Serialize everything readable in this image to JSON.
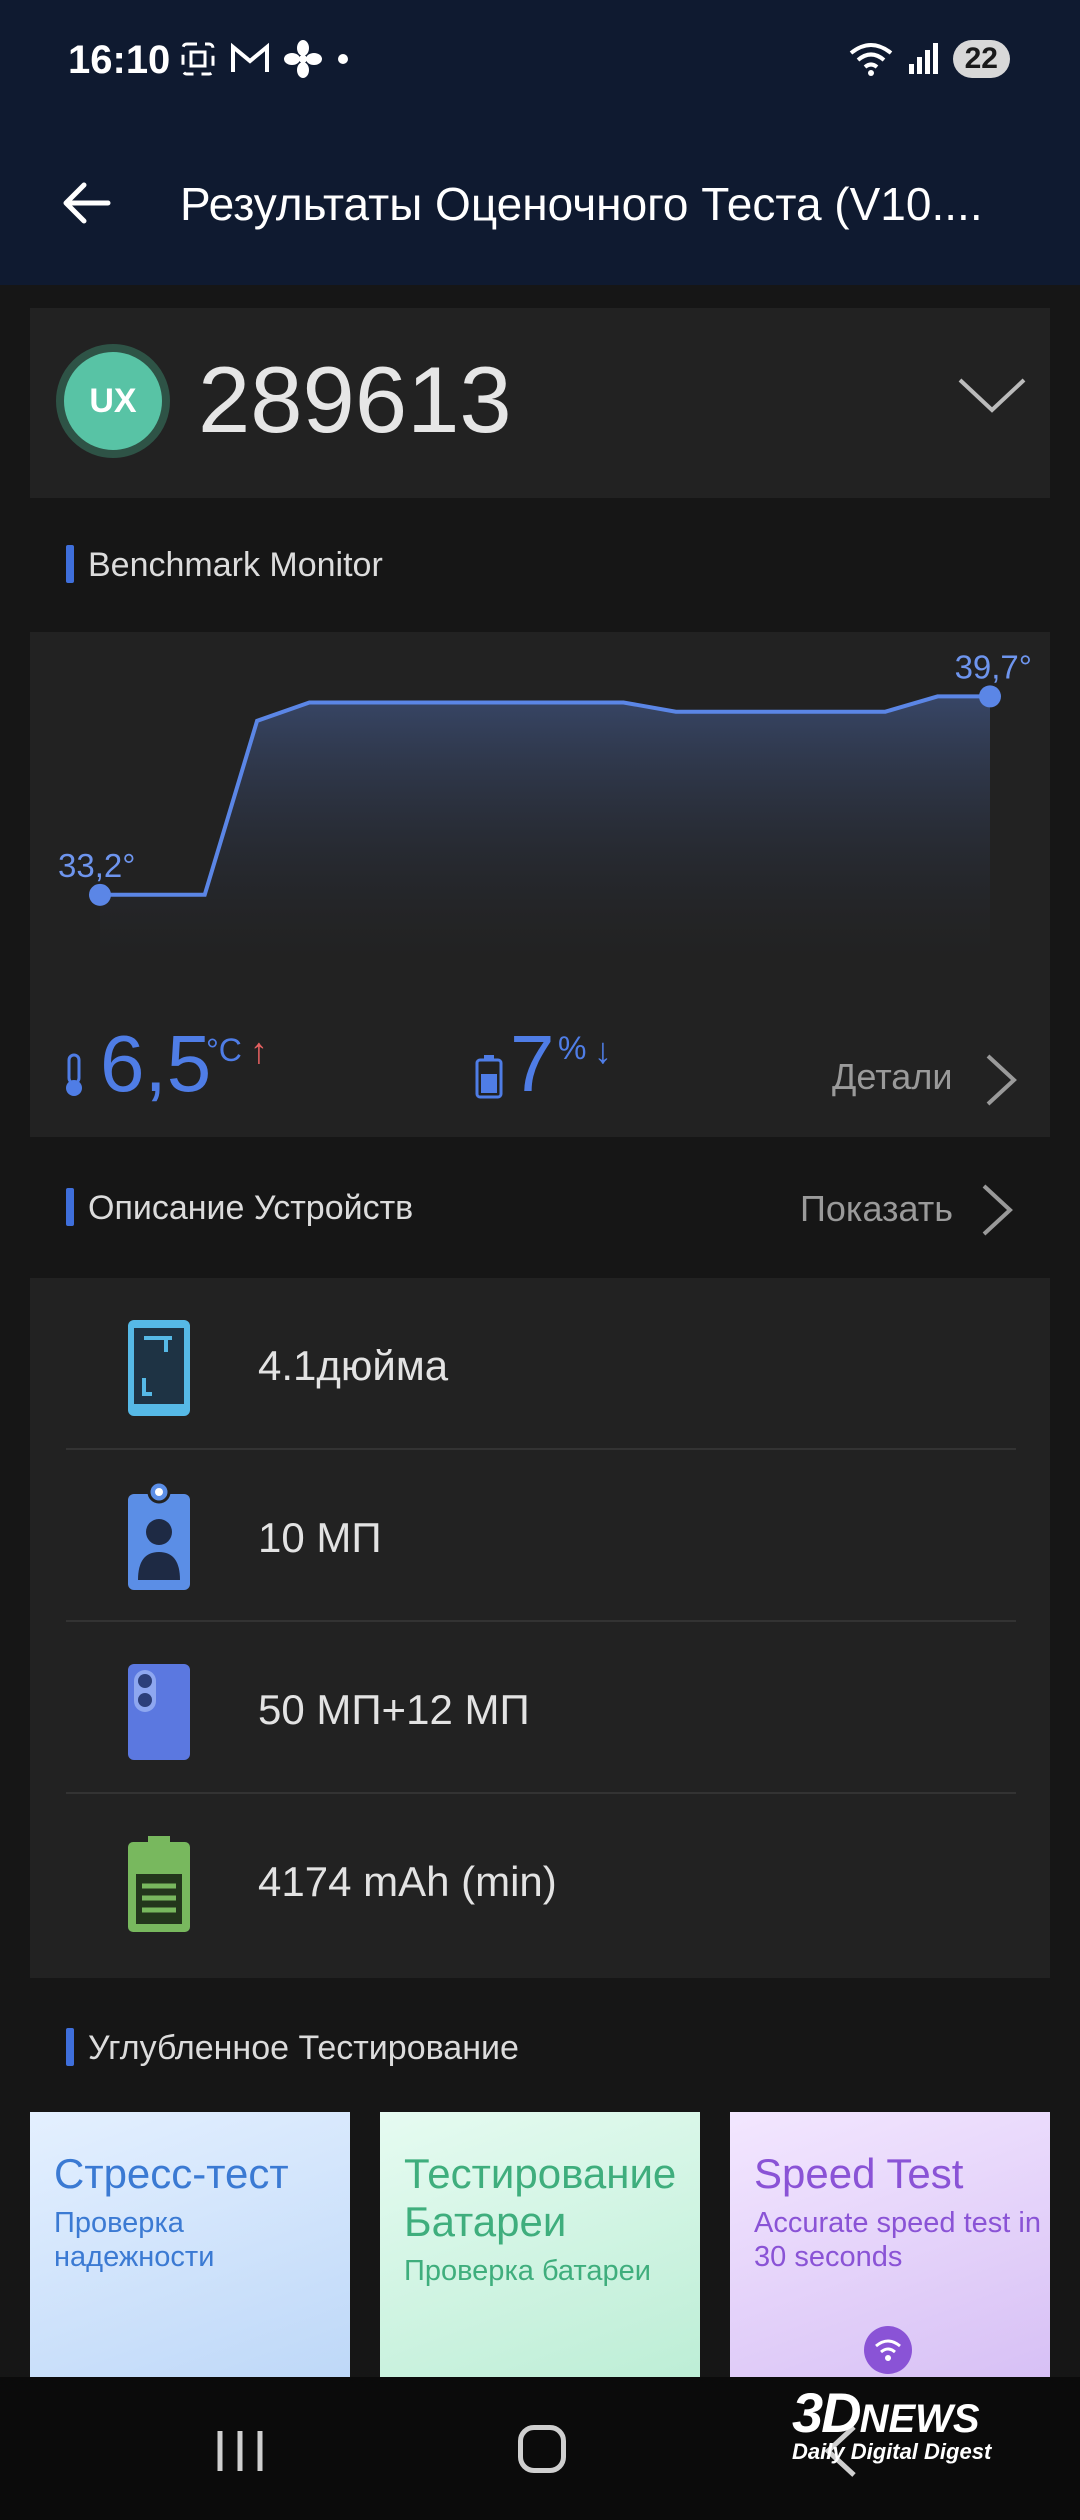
{
  "status_bar": {
    "time": "16:10",
    "battery": "22"
  },
  "app_bar": {
    "title": "Результаты Оценочного Теста (V10...."
  },
  "score": {
    "badge": "UX",
    "value": "289613"
  },
  "benchmark_monitor": {
    "title": "Benchmark Monitor",
    "start_label": "33,2°",
    "end_label": "39,7°",
    "temp_delta": "6,5",
    "temp_unit": "°C",
    "battery_delta": "7",
    "battery_unit": "%",
    "details": "Детали",
    "accent": "#4f7de6"
  },
  "chart_data": {
    "type": "area",
    "x": [
      0,
      1,
      2,
      3,
      4,
      5,
      6,
      7,
      8,
      9,
      10,
      11,
      12,
      13,
      14,
      15,
      16,
      17
    ],
    "y": [
      33.2,
      33.2,
      33.2,
      38.9,
      39.5,
      39.5,
      39.5,
      39.5,
      39.5,
      39.5,
      39.5,
      39.2,
      39.2,
      39.2,
      39.2,
      39.2,
      39.7,
      39.7
    ],
    "ylim": [
      31.0,
      40.5
    ],
    "point_labels": [
      "33,2°",
      "39,7°"
    ]
  },
  "device_description": {
    "title": "Описание Устройств",
    "show": "Показать",
    "items": [
      {
        "icon": "screen-size-icon",
        "text": "4.1дюйма"
      },
      {
        "icon": "front-camera-icon",
        "text": "10 МП"
      },
      {
        "icon": "rear-camera-icon",
        "text": "50 МП+12 МП"
      },
      {
        "icon": "battery-capacity-icon",
        "text": "4174 mAh (min)"
      }
    ]
  },
  "deep_testing": {
    "title": "Углубленное Тестирование",
    "tiles": [
      {
        "title": "Стресс-тест",
        "subtitle": "Проверка надежности"
      },
      {
        "title": "Тестирование Батареи",
        "subtitle": "Проверка батареи"
      },
      {
        "title": "Speed Test",
        "subtitle": "Accurate speed test in 30 seconds"
      }
    ]
  },
  "watermark": {
    "brand": "3D",
    "brand2": "NEWS",
    "tagline": "Daily Digital Digest"
  }
}
